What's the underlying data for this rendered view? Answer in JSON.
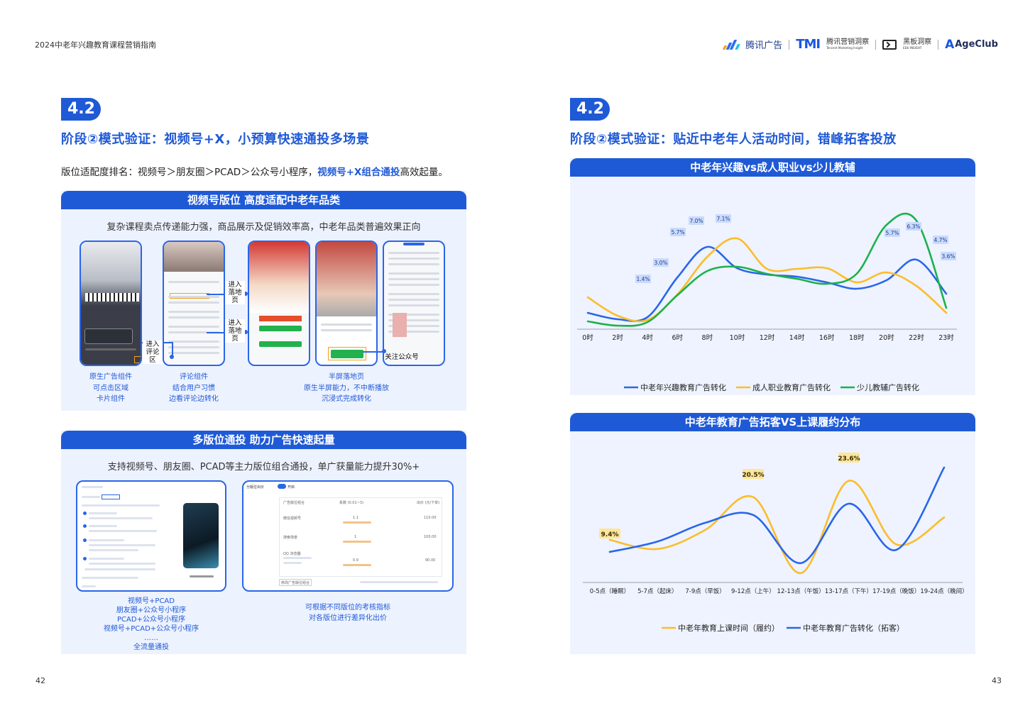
{
  "header": {
    "doc_title": "2024中老年兴趣教育课程营销指南",
    "logos": {
      "tencent_ads": "腾讯广告",
      "tmi_mark": "TMI",
      "tmi_name": "腾讯营销洞察",
      "tmi_en": "Tencent Marketing Insight",
      "edu_name": "黑板洞察",
      "edu_en": "EDU INSIGHT",
      "ageclub": "AgeClub"
    }
  },
  "left_page": {
    "badge": "4.2",
    "title": "阶段②模式验证：视频号+X，小预算快速通投多场景",
    "intro_main": "版位适配度排名：视频号＞朋友圈＞PCAD＞公众号小程序，",
    "intro_highlight": "视频号+X组合通投",
    "intro_tail": "高效起量。",
    "panel1": {
      "header": "视频号版位 高度适配中老年品类",
      "subtitle": "复杂课程卖点传递能力强，商品展示及促销效率高，中老年品类普遍效果正向",
      "callouts": {
        "comment": "进入\n评论区",
        "landing1": "进入\n落地页",
        "landing2": "进入\n落地页",
        "follow": "关注公众号"
      },
      "captions": {
        "native": [
          "原生广告组件",
          "可点击区域",
          "卡片组件"
        ],
        "comment": [
          "评论组件",
          "结合用户习惯",
          "边看评论边转化"
        ],
        "halfscreen": [
          "半屏落地页",
          "原生半屏能力，不中断播放",
          "沉浸式完成转化"
        ]
      }
    },
    "panel2": {
      "header": "多版位通投 助力广告快速起量",
      "subtitle": "支持视频号、朋友圈、PCAD等主力版位组合通投，单广获量能力提升30%+",
      "combos": [
        "视频号+PCAD",
        "朋友圈+公众号小程序",
        "PCAD+公众号小程序",
        "视频号+PCAD+公众号小程序",
        "……",
        "全流量通投"
      ],
      "bid_text": [
        "可根据不同版位的考核指标",
        "对各版位进行差异化出价"
      ],
      "screen_right": {
        "toggle_label": "分版位出价",
        "toggle_state": "开启",
        "col_headers": [
          "广告版位组合",
          "系数 (0.01~3)",
          "出价 (元/下单)"
        ],
        "rows": [
          {
            "name": "微信视频号",
            "coef": "1.1",
            "price": "110.00"
          },
          {
            "name": "搜索场景",
            "coef": "1",
            "price": "100.00"
          },
          {
            "name": "QQ 浏览器",
            "coef": "0.9",
            "price": "90.00"
          }
        ],
        "footer_btn": "修改广告版位组合"
      }
    },
    "page_number": "42"
  },
  "right_page": {
    "badge": "4.2",
    "title": "阶段②模式验证：贴近中老年人活动时间，错峰拓客投放",
    "chart1_header": "中老年兴趣vs成人职业vs少儿教辅",
    "chart2_header": "中老年教育广告拓客VS上课履约分布",
    "page_number": "43"
  },
  "colors": {
    "blue": "#1f5ad6",
    "line_blue": "#2a66e8",
    "line_yellow": "#fbbd2a",
    "line_green": "#1db14b",
    "panel_bg": "#edf2ff"
  },
  "chart_data": [
    {
      "type": "line",
      "title": "中老年兴趣vs成人职业vs少儿教辅",
      "categories": [
        "0时",
        "2时",
        "4时",
        "6时",
        "8时",
        "10时",
        "12时",
        "14时",
        "16时",
        "18时",
        "20时",
        "22时",
        "23时"
      ],
      "series": [
        {
          "name": "中老年兴趣教育广告转化",
          "color": "#2a66e8",
          "values": [
            0.9,
            0.45,
            0.6,
            3.4,
            5.55,
            4.05,
            3.6,
            3.45,
            3.05,
            2.6,
            3.2,
            4.65,
            2.25
          ]
        },
        {
          "name": "成人职业教育广告转化",
          "color": "#fbbd2a",
          "values": [
            2.0,
            0.7,
            0.4,
            2.2,
            4.85,
            6.15,
            4.0,
            4.0,
            4.05,
            3.05,
            3.75,
            2.8,
            0.9
          ]
        },
        {
          "name": "少儿教辅广告转化",
          "color": "#1db14b",
          "values": [
            0.3,
            0.0,
            0.25,
            2.15,
            3.85,
            4.15,
            3.65,
            3.3,
            2.95,
            3.65,
            7.1,
            7.4,
            1.25
          ]
        }
      ],
      "data_labels": [
        {
          "x": "4时",
          "value": "1.4%"
        },
        {
          "x": "5时",
          "value": "3.0%"
        },
        {
          "x": "6时",
          "value": "5.7%"
        },
        {
          "x": "7时",
          "value": "7.0%"
        },
        {
          "x": "9时",
          "value": "7.1%"
        },
        {
          "x": "21时",
          "value": "5.7%"
        },
        {
          "x": "22时",
          "value": "6.3%"
        },
        {
          "x": "23时(a)",
          "value": "4.7%"
        },
        {
          "x": "23时(b)",
          "value": "3.6%"
        }
      ],
      "legend": "bottom",
      "grid": false
    },
    {
      "type": "line",
      "title": "中老年教育广告拓客VS上课履约分布",
      "categories": [
        "0-5点（睡眠）",
        "5-7点（起床）",
        "7-9点（早饭）",
        "9-12点（上午）",
        "12-13点（午饭）",
        "13-17点（下午）",
        "17-19点（晚饭）",
        "19-24点（晚间）"
      ],
      "series": [
        {
          "name": "中老年教育上课时间（履约）",
          "color": "#fbbd2a",
          "values": [
            9.4,
            7.2,
            11.8,
            19.7,
            1.4,
            23.6,
            8.3,
            14.8
          ]
        },
        {
          "name": "中老年教育广告转化（拓客）",
          "color": "#2a66e8",
          "values": [
            6.5,
            9.0,
            13.5,
            15.4,
            3.8,
            18.1,
            7.0,
            26.8
          ]
        }
      ],
      "data_labels": [
        {
          "x": "0-5点（睡眠）",
          "value": "9.4%"
        },
        {
          "x": "9-12点（上午）",
          "value": "20.5%"
        },
        {
          "x": "13-17点（下午）",
          "value": "23.6%"
        }
      ],
      "legend": "bottom",
      "grid": false
    }
  ]
}
